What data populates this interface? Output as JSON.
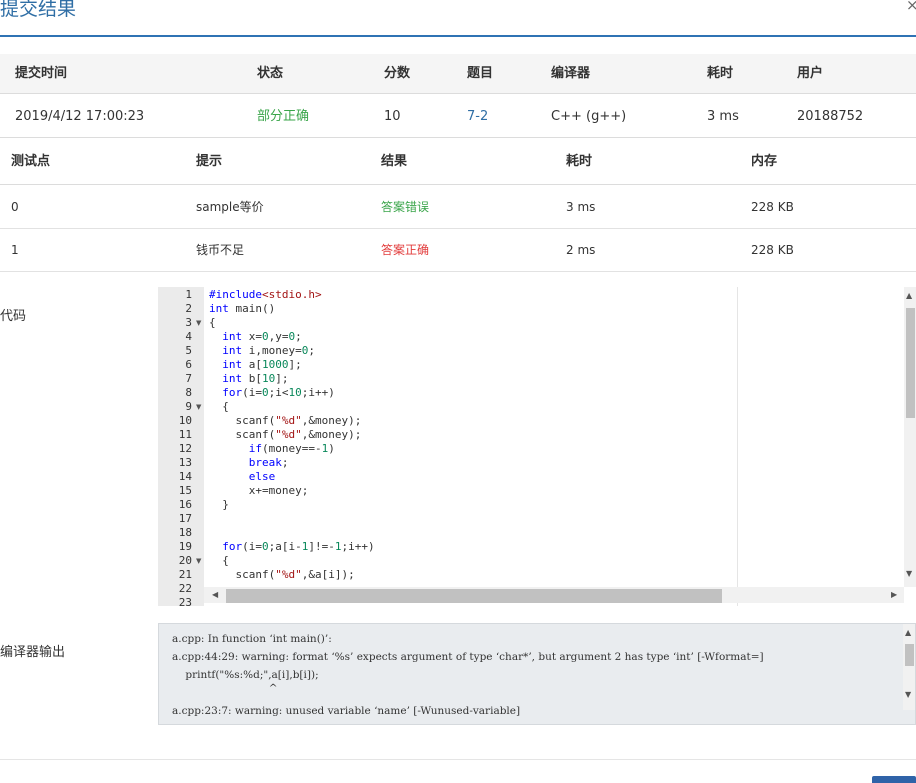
{
  "dialog": {
    "title": "提交结果",
    "close": "×"
  },
  "summary": {
    "headers": [
      "提交时间",
      "状态",
      "分数",
      "题目",
      "编译器",
      "耗时",
      "用户"
    ],
    "row": {
      "time": "2019/4/12 17:00:23",
      "status": "部分正确",
      "score": "10",
      "problem": "7-2",
      "compiler": "C++ (g++)",
      "elapsed": "3 ms",
      "user": "20188752"
    }
  },
  "cases": {
    "headers": [
      "测试点",
      "提示",
      "结果",
      "耗时",
      "内存"
    ],
    "rows": [
      {
        "id": "0",
        "hint": "sample等价",
        "result": "答案错误",
        "time": "3 ms",
        "memory": "228 KB"
      },
      {
        "id": "1",
        "hint": "钱币不足",
        "result": "答案正确",
        "time": "2 ms",
        "memory": "228 KB"
      }
    ]
  },
  "code_label": "代码",
  "compiler_output_label": "编译器输出",
  "code_lines": [
    "#include<stdio.h>",
    "int main()",
    "{",
    "  int x=0,y=0;",
    "  int i,money=0;",
    "  int a[1000];",
    "  int b[10];",
    "  for(i=0;i<10;i++)",
    "  {",
    "    scanf(\"%d\",&money);",
    "    scanf(\"%d\",&money);",
    "      if(money==-1)",
    "      break;",
    "      else",
    "      x+=money;",
    "  }",
    "",
    "",
    "  for(i=0;a[i-1]!=-1;i++)",
    "  {",
    "    scanf(\"%d\",&a[i]);",
    "",
    ""
  ],
  "line_numbers": [
    "1",
    "2",
    "3",
    "4",
    "5",
    "6",
    "7",
    "8",
    "9",
    "10",
    "11",
    "12",
    "13",
    "14",
    "15",
    "16",
    "17",
    "18",
    "19",
    "20",
    "21",
    "22",
    "23"
  ],
  "compiler_output": [
    "a.cpp: In function ‘int main()’:",
    "a.cpp:44:29: warning: format ‘%s’ expects argument of type ‘char*’, but argument 2 has type ‘int’ [-Wformat=]",
    "    printf(\"%s:%d;\",a[i],b[i]);",
    "                             ^",
    "a.cpp:23:7: warning: unused variable ‘name’ [-Wunused-variable]"
  ],
  "colors": {
    "accent": "#2f73b4",
    "correct": "#3aa54a",
    "wrong": "#e23b3b"
  },
  "icons": {
    "fold": "fold-arrow-icon",
    "scroll": "scroll-arrow-icon"
  }
}
